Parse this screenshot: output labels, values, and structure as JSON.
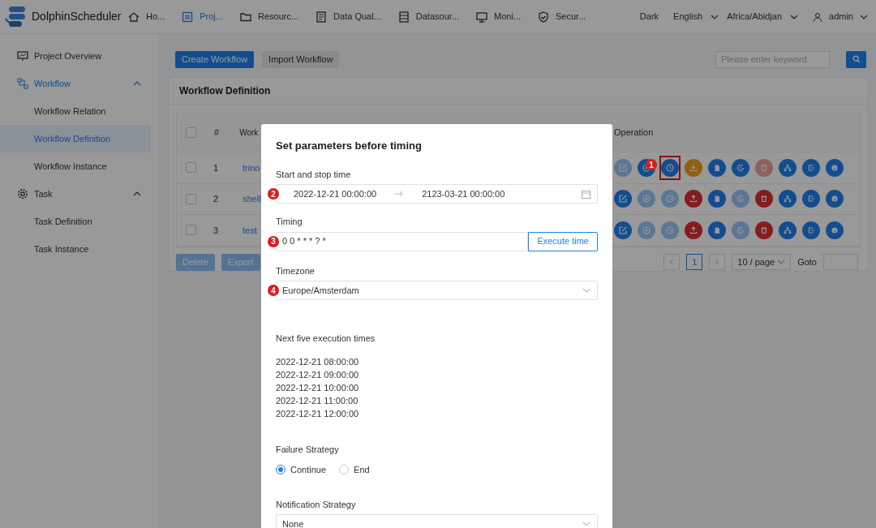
{
  "header": {
    "logo": "DolphinScheduler",
    "nav": [
      {
        "label": "Ho...",
        "kind": "home",
        "selected": false
      },
      {
        "label": "Proj...",
        "kind": "project",
        "selected": true
      },
      {
        "label": "Resourc...",
        "kind": "folder",
        "selected": false
      },
      {
        "label": "Data Qual...",
        "kind": "doc",
        "selected": false
      },
      {
        "label": "Datasour...",
        "kind": "db",
        "selected": false
      },
      {
        "label": "Moni...",
        "kind": "monitor",
        "selected": false
      },
      {
        "label": "Secur...",
        "kind": "shield",
        "selected": false
      }
    ],
    "theme": "Dark",
    "language": "English",
    "timezone": "Africa/Abidjan",
    "user": "admin"
  },
  "sidebar": {
    "items": [
      {
        "label": "Project Overview",
        "kind": "overview",
        "selected": false
      },
      {
        "label": "Workflow",
        "kind": "workflow",
        "selected": false,
        "expanded": true,
        "children": [
          {
            "label": "Workflow Relation",
            "selected": false
          },
          {
            "label": "Workflow Definition",
            "selected": true
          },
          {
            "label": "Workflow Instance",
            "selected": false
          }
        ]
      },
      {
        "label": "Task",
        "kind": "gear",
        "selected": false,
        "expanded": true,
        "children": [
          {
            "label": "Task Definition",
            "selected": false
          },
          {
            "label": "Task Instance",
            "selected": false
          }
        ]
      }
    ]
  },
  "toolbar": {
    "buttons": [
      "Create Workflow",
      "Import Workflow"
    ],
    "search_placeholder": "Please enter keyword"
  },
  "card": {
    "title": "Workflow Definition",
    "columns": [
      "#",
      "Work",
      "Operation"
    ],
    "all_checked": false,
    "rows": [
      {
        "index": "1",
        "name": "trino",
        "checked": false,
        "operations": [
          {
            "kind": "edit",
            "disabled": true
          },
          {
            "kind": "run",
            "disabled": false,
            "marker": "1"
          },
          {
            "kind": "timing",
            "disabled": false,
            "highlighted": true
          },
          {
            "kind": "release",
            "online": true,
            "disabled": false
          },
          {
            "kind": "copy",
            "disabled": false
          },
          {
            "kind": "version",
            "disabled": false
          },
          {
            "kind": "delete",
            "disabled": true
          },
          {
            "kind": "tree",
            "disabled": false
          },
          {
            "kind": "redirect",
            "disabled": false
          },
          {
            "kind": "info",
            "disabled": false
          }
        ]
      },
      {
        "index": "2",
        "name": "shell",
        "checked": false,
        "operations": [
          {
            "kind": "edit",
            "disabled": false
          },
          {
            "kind": "run",
            "disabled": true
          },
          {
            "kind": "timing",
            "disabled": true
          },
          {
            "kind": "release",
            "online": false,
            "disabled": false
          },
          {
            "kind": "copy",
            "disabled": false
          },
          {
            "kind": "version",
            "disabled": true
          },
          {
            "kind": "delete",
            "disabled": false
          },
          {
            "kind": "tree",
            "disabled": false
          },
          {
            "kind": "redirect",
            "disabled": false
          },
          {
            "kind": "info",
            "disabled": false
          }
        ]
      },
      {
        "index": "3",
        "name": "test",
        "checked": false,
        "operations": [
          {
            "kind": "edit",
            "disabled": false
          },
          {
            "kind": "run",
            "disabled": true
          },
          {
            "kind": "timing",
            "disabled": true
          },
          {
            "kind": "release",
            "online": false,
            "disabled": false
          },
          {
            "kind": "copy",
            "disabled": false
          },
          {
            "kind": "version",
            "disabled": true
          },
          {
            "kind": "delete",
            "disabled": false
          },
          {
            "kind": "tree",
            "disabled": false
          },
          {
            "kind": "redirect",
            "disabled": false
          },
          {
            "kind": "info",
            "disabled": false
          }
        ]
      }
    ],
    "bulk_buttons": [
      {
        "label": "Delete",
        "disabled": true
      },
      {
        "label": "Export",
        "disabled": true
      }
    ],
    "pagination": {
      "page": "1",
      "page_size": "10 / page",
      "goto": "Goto"
    }
  },
  "dialog": {
    "title": "Set parameters before timing",
    "start_stop": {
      "label": "Start and stop time",
      "marker": "2",
      "start": "2022-12-21 00:00:00",
      "end": "2123-03-21 00:00:00"
    },
    "timing": {
      "label": "Timing",
      "marker": "3",
      "value": "0 0 * * * ? *",
      "button": "Execute time"
    },
    "timezone": {
      "label": "Timezone",
      "marker": "4",
      "value": "Europe/Amsterdam"
    },
    "next_times": {
      "label": "Next five execution times",
      "times": [
        "2022-12-21 08:00:00",
        "2022-12-21 09:00:00",
        "2022-12-21 10:00:00",
        "2022-12-21 11:00:00",
        "2022-12-21 12:00:00"
      ]
    },
    "failure_strategy": {
      "label": "Failure Strategy",
      "options": [
        {
          "label": "Continue",
          "selected": true
        },
        {
          "label": "End",
          "selected": false
        }
      ]
    },
    "notification_strategy": {
      "label": "Notification Strategy",
      "value": "None"
    }
  }
}
